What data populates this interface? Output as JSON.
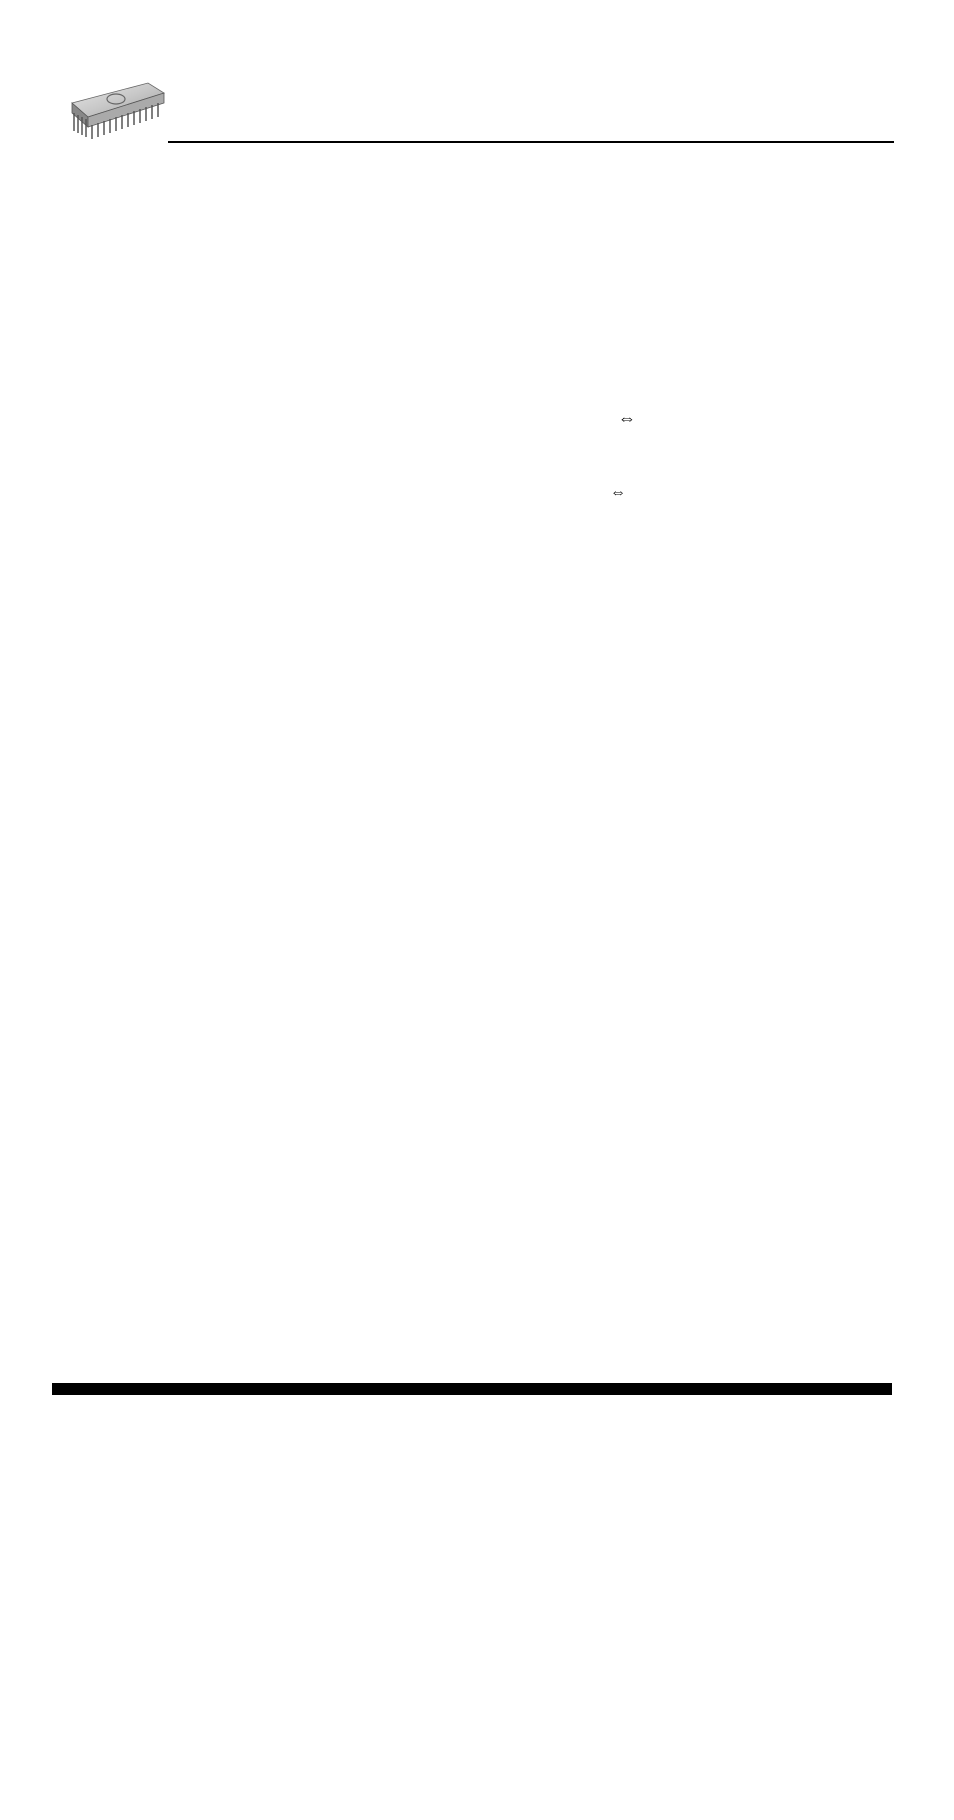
{
  "header": {
    "icon_name": "chip-icon"
  },
  "content": {
    "arrow_symbol_1": "⇔",
    "arrow_symbol_2": "⇔"
  },
  "footer": {
    "bar": true
  }
}
